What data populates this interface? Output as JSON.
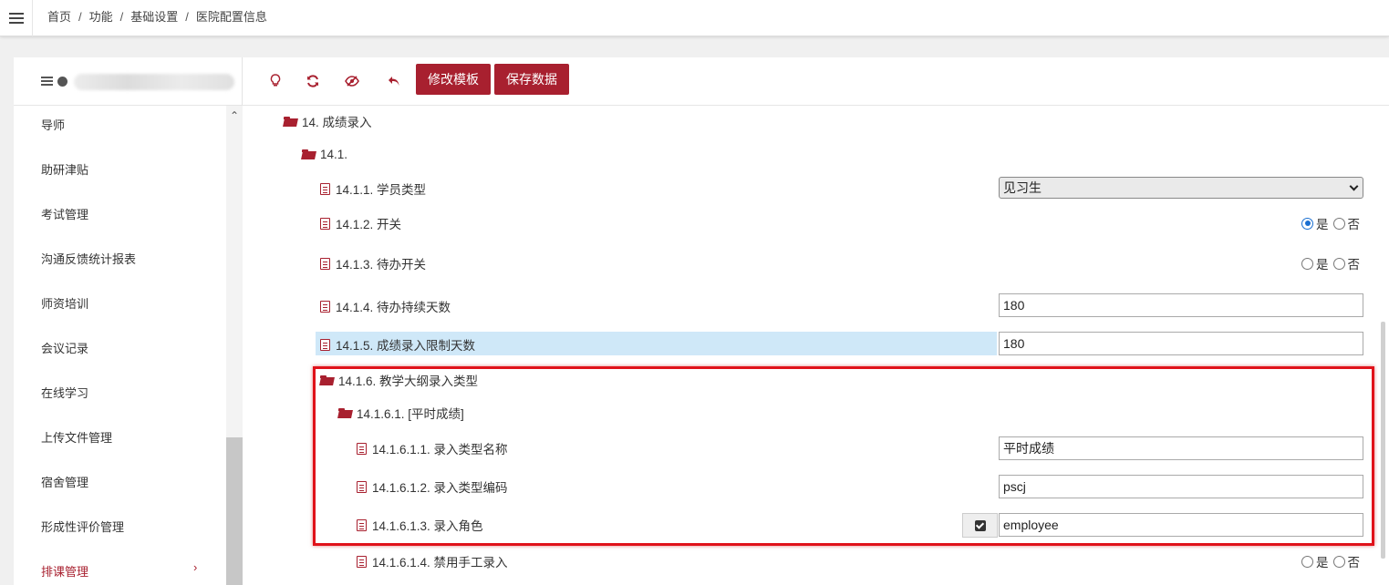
{
  "breadcrumb": [
    "首页",
    "功能",
    "基础设置",
    "医院配置信息"
  ],
  "sidebar": {
    "items": [
      {
        "label": "导师"
      },
      {
        "label": "助研津贴"
      },
      {
        "label": "考试管理"
      },
      {
        "label": "沟通反馈统计报表"
      },
      {
        "label": "师资培训"
      },
      {
        "label": "会议记录"
      },
      {
        "label": "在线学习"
      },
      {
        "label": "上传文件管理"
      },
      {
        "label": "宿舍管理"
      },
      {
        "label": "形成性评价管理"
      },
      {
        "label": "排课管理",
        "active": true,
        "arrow": "›"
      }
    ]
  },
  "toolbar": {
    "icons": [
      "lightbulb-icon",
      "refresh-icon",
      "eye-slash-icon",
      "undo-icon"
    ],
    "edit_template_label": "修改模板",
    "save_data_label": "保存数据"
  },
  "tree": {
    "n14": "14. 成绩录入",
    "n14_1": "14.1.",
    "n14_1_1": "14.1.1. 学员类型",
    "n14_1_1_value": "见习生",
    "n14_1_2": "14.1.2. 开关",
    "n14_1_3": "14.1.3. 待办开关",
    "n14_1_4": "14.1.4. 待办持续天数",
    "n14_1_4_value": "180",
    "n14_1_5": "14.1.5. 成绩录入限制天数",
    "n14_1_5_value": "180",
    "n14_1_6": "14.1.6. 教学大纲录入类型",
    "n14_1_6_1": "14.1.6.1. [平时成绩]",
    "n14_1_6_1_1": "14.1.6.1.1. 录入类型名称",
    "n14_1_6_1_1_value": "平时成绩",
    "n14_1_6_1_2": "14.1.6.1.2. 录入类型编码",
    "n14_1_6_1_2_value": "pscj",
    "n14_1_6_1_3": "14.1.6.1.3. 录入角色",
    "n14_1_6_1_3_value": "employee",
    "n14_1_6_1_4": "14.1.6.1.4. 禁用手工录入"
  },
  "radio": {
    "yes": "是",
    "no": "否"
  },
  "radio_states": {
    "n14_1_2": "是",
    "n14_1_3": "",
    "n14_1_6_1_4": ""
  },
  "colors": {
    "accent": "#a8202f",
    "highlight_row": "#cfe8f8",
    "annotation_box": "#e0121a",
    "radio_selected": "#1a6fd1"
  }
}
